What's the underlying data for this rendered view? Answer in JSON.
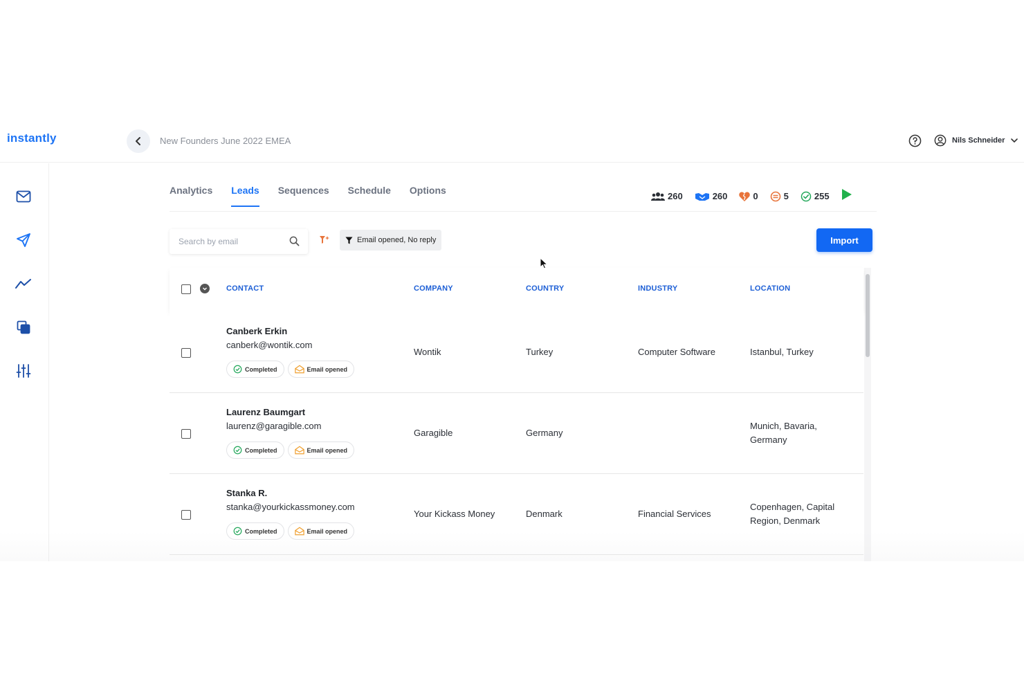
{
  "header": {
    "logo": "instantly",
    "breadcrumb": "New Founders June 2022 EMEA",
    "user_name": "Nils Schneider"
  },
  "sidebar": {
    "items": [
      {
        "icon": "mail-icon"
      },
      {
        "icon": "send-icon"
      },
      {
        "icon": "analytics-icon"
      },
      {
        "icon": "copy-icon"
      },
      {
        "icon": "sliders-icon"
      }
    ]
  },
  "tabs": [
    {
      "label": "Analytics"
    },
    {
      "label": "Leads",
      "active": true
    },
    {
      "label": "Sequences"
    },
    {
      "label": "Schedule"
    },
    {
      "label": "Options"
    }
  ],
  "stats": [
    {
      "icon": "users-icon",
      "value": "260"
    },
    {
      "icon": "handshake-icon",
      "value": "260"
    },
    {
      "icon": "broken-heart-icon",
      "value": "0"
    },
    {
      "icon": "bounce-icon",
      "value": "5"
    },
    {
      "icon": "check-circle-icon",
      "value": "255"
    }
  ],
  "toolbar": {
    "search_placeholder": "Search by email",
    "filter_label": "Email opened, No reply",
    "import_label": "Import"
  },
  "table": {
    "columns": [
      "CONTACT",
      "COMPANY",
      "COUNTRY",
      "INDUSTRY",
      "LOCATION"
    ],
    "badge_completed": "Completed",
    "badge_opened": "Email opened",
    "rows": [
      {
        "name": "Canberk Erkin",
        "email": "canberk@wontik.com",
        "company": "Wontik",
        "country": "Turkey",
        "industry": "Computer Software",
        "location_1": "Istanbul, Turkey",
        "location_2": ""
      },
      {
        "name": "Laurenz Baumgart",
        "email": "laurenz@garagible.com",
        "company": "Garagible",
        "country": "Germany",
        "industry": "",
        "location_1": "Munich, Bavaria,",
        "location_2": "Germany"
      },
      {
        "name": "Stanka R.",
        "email": "stanka@yourkickassmoney.com",
        "company": "Your Kickass Money",
        "country": "Denmark",
        "industry": "Financial Services",
        "location_1": "Copenhagen, Capital",
        "location_2": "Region, Denmark"
      }
    ]
  },
  "colors": {
    "accent": "#1d74f5",
    "import_button": "#1268f3",
    "play": "#22b14c",
    "completed_check": "#22a75a",
    "opened_icon": "#f0a030"
  }
}
